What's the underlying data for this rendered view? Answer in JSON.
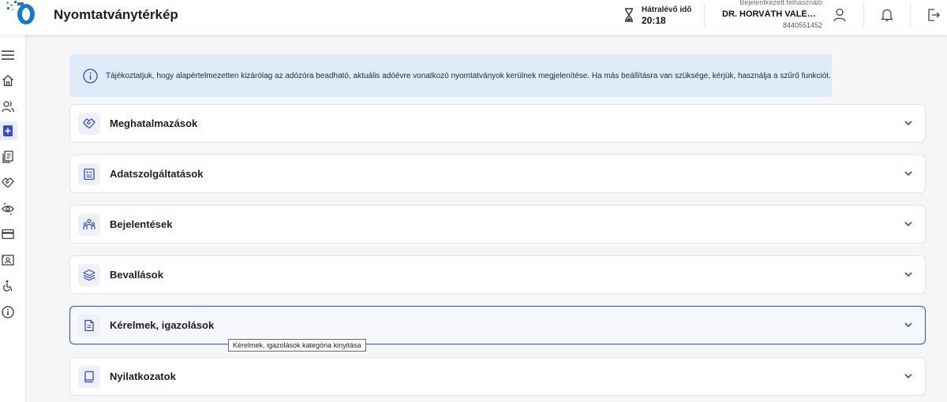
{
  "header": {
    "title": "Nyomtatványtérkép",
    "timer_label": "Hátralévő idő",
    "timer_value": "20:18",
    "user_caption": "Bejelentkezett felhasználó",
    "user_name": "DR. HORVÁTH VALÉRI…",
    "user_id": "8440551452"
  },
  "sidebar": {
    "items": [
      {
        "icon": "menu-icon"
      },
      {
        "icon": "home-icon"
      },
      {
        "icon": "users-icon"
      },
      {
        "icon": "add-document-icon",
        "active": true
      },
      {
        "icon": "documents-icon"
      },
      {
        "icon": "handshake-icon"
      },
      {
        "icon": "eye-exchange-icon"
      },
      {
        "icon": "card-icon"
      },
      {
        "icon": "id-card-icon"
      },
      {
        "icon": "accessibility-icon"
      },
      {
        "icon": "info-icon"
      }
    ]
  },
  "info_banner": {
    "text": "Tájékoztatjuk, hogy alapértelmezetten kizárólag az adózóra beadható, aktuális adóévre vonatkozó nyomtatványok kerülnek megjelenítése. Ha más beállításra van szüksége, kérjük, használja a szűrő funkciót."
  },
  "categories": [
    {
      "label": "Meghatalmazások",
      "icon": "handshake-icon"
    },
    {
      "label": "Adatszolgáltatások",
      "icon": "list-document-icon"
    },
    {
      "label": "Bejelentések",
      "icon": "people-group-icon"
    },
    {
      "label": "Bevallások",
      "icon": "layers-icon"
    },
    {
      "label": "Kérelmek, igazolások",
      "icon": "document-lines-icon",
      "focused": true
    },
    {
      "label": "Nyilatkozatok",
      "icon": "book-icon"
    }
  ],
  "tooltip": {
    "text": "Kérelmek, igazolások kategória kinyitása"
  },
  "colors": {
    "accent": "#3b4cc0",
    "banner_bg": "#deebf8",
    "logo_blue": "#1a78c8"
  }
}
